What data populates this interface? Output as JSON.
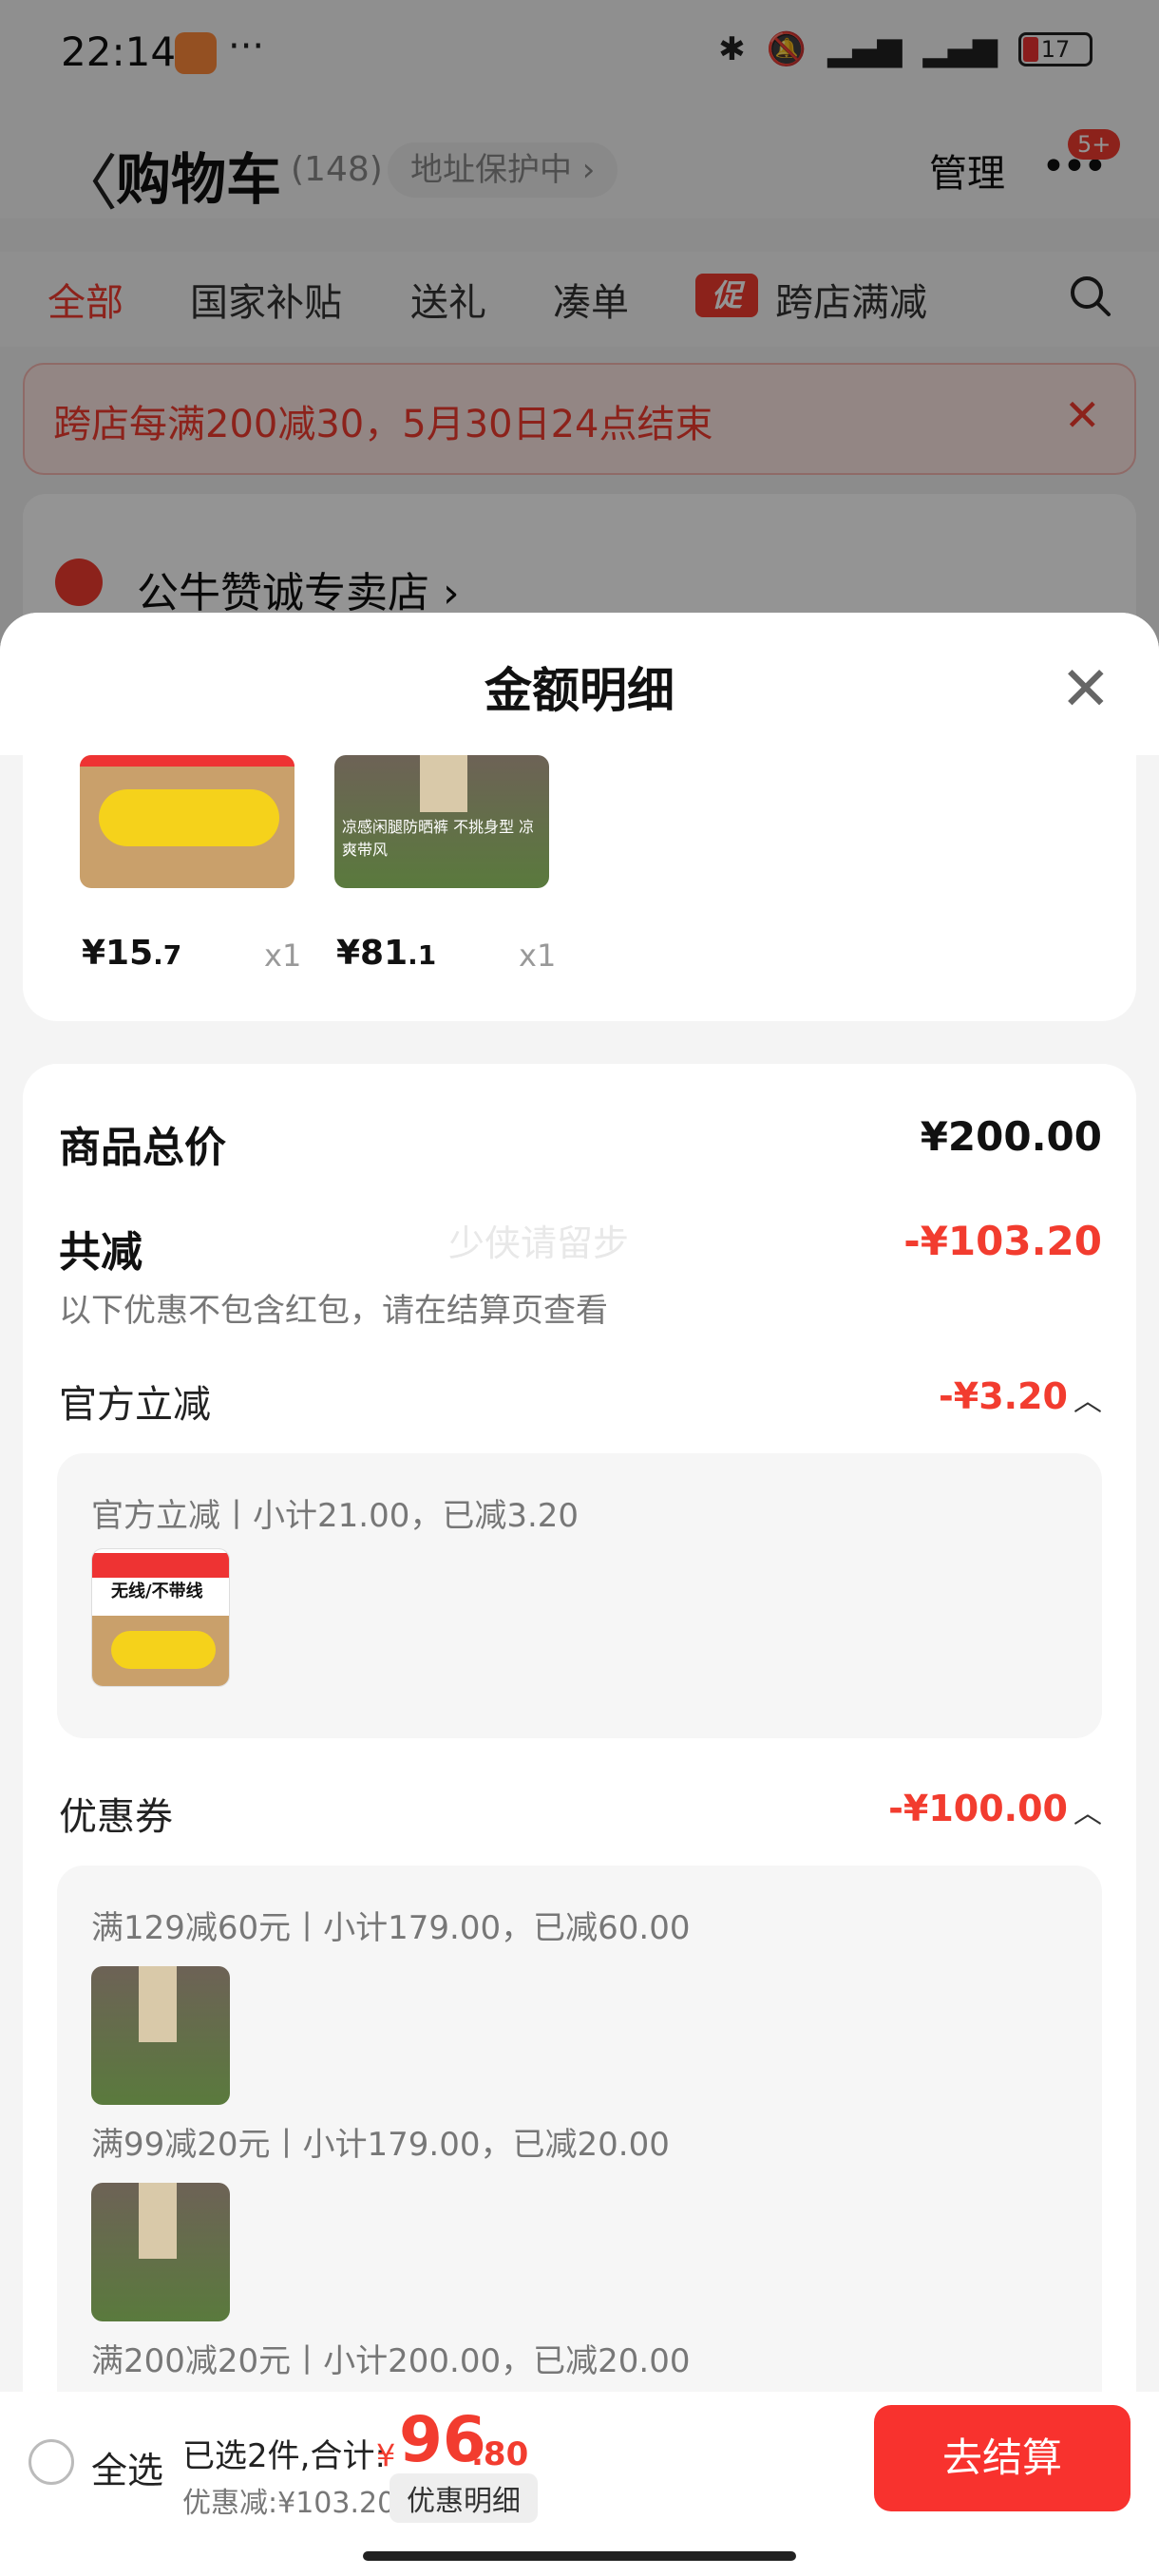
{
  "status_bar": {
    "time": "22:14",
    "dots": "···",
    "battery": "17"
  },
  "header": {
    "back": "〈",
    "title": "购物车",
    "count": "(148)",
    "address": "地址保护中 ›",
    "manage": "管理",
    "more": "•••",
    "badge": "5+"
  },
  "tabs": [
    {
      "label": "全部"
    },
    {
      "label": "国家补贴"
    },
    {
      "label": "送礼"
    },
    {
      "label": "凑单"
    },
    {
      "label": "跨店满减"
    }
  ],
  "promo_tag": "促",
  "notice": {
    "text": "跨店每满200减30，5月30日24点结束",
    "close": "✕"
  },
  "store": {
    "name": "公牛赞诚专卖店 ›"
  },
  "sheet": {
    "title": "金额明细",
    "close": "✕",
    "products": [
      {
        "price_int": "¥15",
        "price_dec": ".7",
        "qty": "x1",
        "thumb_text": ""
      },
      {
        "price_int": "¥81",
        "price_dec": ".1",
        "qty": "x1",
        "thumb_text": "凉感闲腿防晒裤 不挑身型 凉爽带风"
      }
    ],
    "summary": {
      "total_label": "商品总价",
      "total_value": "¥200.00",
      "reduce_label": "共减",
      "reduce_value": "-¥103.20",
      "note": "以下优惠不包含红包，请在结算页查看",
      "watermark": "少侠请留步"
    },
    "official": {
      "label": "官方立减",
      "value": "-¥3.20",
      "line": "官方立减丨小计21.00，已减3.20",
      "thumb_text": "无线/不带线"
    },
    "coupon": {
      "label": "优惠券",
      "value": "-¥100.00",
      "lines": [
        "满129减60元丨小计179.00，已减60.00",
        "满99减20元丨小计179.00，已减20.00",
        "满200减20元丨小计200.00，已减20.00"
      ]
    }
  },
  "bottom": {
    "select_all": "全选",
    "selected": "已选2件,合计:",
    "currency": "¥",
    "total_int": "96",
    "total_dec": ".80",
    "discount": "优惠减:¥103.20",
    "detail_btn": "优惠明细",
    "checkout": "去结算"
  },
  "colors": {
    "accent": "#f23c2f",
    "checkout": "#f8322e"
  }
}
